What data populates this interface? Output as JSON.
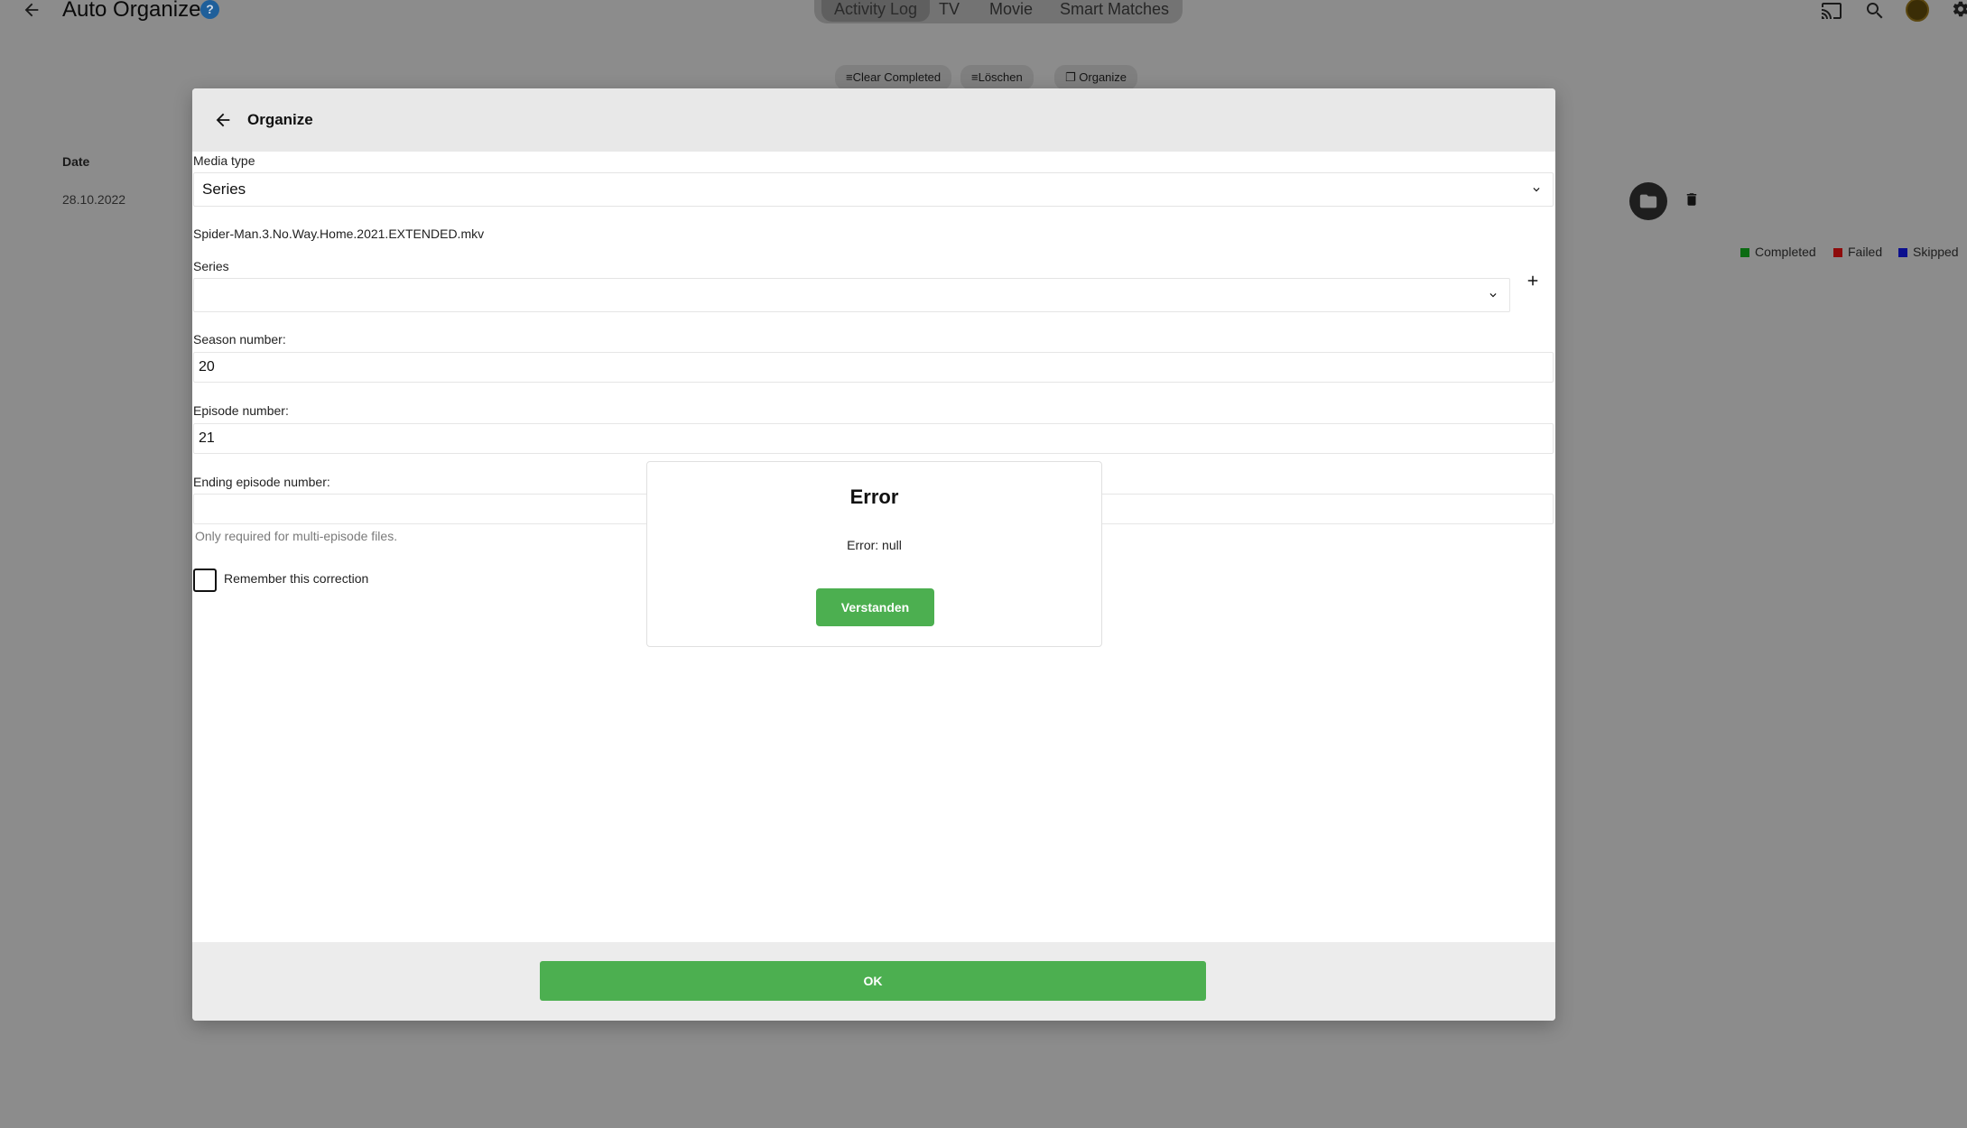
{
  "header": {
    "title": "Auto Organize",
    "help_glyph": "?",
    "tabs": [
      {
        "label": "Activity Log",
        "active": true
      },
      {
        "label": "TV",
        "active": false
      },
      {
        "label": "Movie",
        "active": false
      },
      {
        "label": "Smart Matches",
        "active": false
      }
    ],
    "icons": [
      "back-arrow-icon",
      "cast-icon",
      "search-icon",
      "avatar",
      "gear-icon"
    ]
  },
  "actions": {
    "clear_completed": "Clear Completed",
    "delete": "Löschen",
    "organize": "Organize"
  },
  "table": {
    "date_header": "Date",
    "rows": [
      {
        "date": "28.10.2022"
      }
    ]
  },
  "legend": {
    "completed": {
      "label": "Completed",
      "color": "#0b6b12"
    },
    "failed": {
      "label": "Failed",
      "color": "#8e0b0b"
    },
    "skipped": {
      "label": "Skipped",
      "color": "#0b0f8e"
    }
  },
  "dialog": {
    "title": "Organize",
    "media_type_label": "Media type",
    "media_type_value": "Series",
    "filename": "Spider-Man.3.No.Way.Home.2021.EXTENDED.mkv",
    "series_label": "Series",
    "series_value": "",
    "season_label": "Season number:",
    "season_value": "20",
    "episode_label": "Episode number:",
    "episode_value": "21",
    "ending_episode_label": "Ending episode number:",
    "ending_episode_value": "",
    "ending_episode_hint": "Only required for multi-episode files.",
    "remember_label": "Remember this correction",
    "remember_checked": false,
    "ok_label": "OK"
  },
  "alert": {
    "title": "Error",
    "message": "Error: null",
    "button_label": "Verstanden"
  },
  "colors": {
    "accent_green": "#4caf50",
    "overlay_grey": "#8c8c8c"
  }
}
